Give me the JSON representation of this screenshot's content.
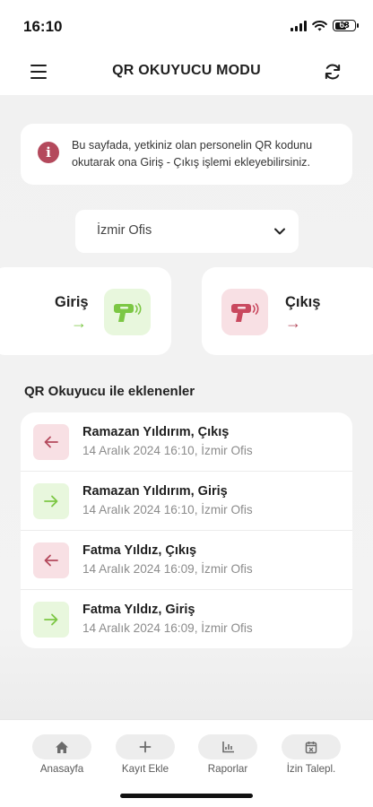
{
  "status_bar": {
    "time": "16:10",
    "battery": "63",
    "battery_level": 0.63
  },
  "header": {
    "title": "QR OKUYUCU MODU",
    "left_icon": "menu-icon",
    "right_icon": "refresh-icon"
  },
  "info": {
    "icon": "info-icon",
    "text": "Bu sayfada, yetkiniz olan personelin QR kodunu okutarak ona Giriş - Çıkış işlemi ekleyebilirsiniz."
  },
  "office_select": {
    "value": "İzmir Ofis",
    "icon": "chevron-down-icon"
  },
  "actions": {
    "entry": {
      "label": "Giriş",
      "arrow": "→",
      "icon": "qr-scanner-icon",
      "color": "#7cc744"
    },
    "exit": {
      "label": "Çıkış",
      "arrow": "→",
      "icon": "qr-scanner-icon",
      "color": "#c9495f"
    }
  },
  "list": {
    "title": "QR Okuyucu ile eklenenler",
    "items": [
      {
        "type": "out",
        "title": "Ramazan Yıldırım, Çıkış",
        "subtitle": "14 Aralık 2024 16:10, İzmir Ofis"
      },
      {
        "type": "in",
        "title": "Ramazan Yıldırım, Giriş",
        "subtitle": "14 Aralık 2024 16:10, İzmir Ofis"
      },
      {
        "type": "out",
        "title": "Fatma Yıldız, Çıkış",
        "subtitle": "14 Aralık 2024 16:09, İzmir Ofis"
      },
      {
        "type": "in",
        "title": "Fatma Yıldız, Giriş",
        "subtitle": "14 Aralık 2024 16:09, İzmir Ofis"
      }
    ]
  },
  "tabbar": {
    "tabs": [
      {
        "label": "Anasayfa",
        "icon": "home-icon"
      },
      {
        "label": "Kayıt Ekle",
        "icon": "plus-icon"
      },
      {
        "label": "Raporlar",
        "icon": "chart-icon"
      },
      {
        "label": "İzin Talepl.",
        "icon": "calendar-icon"
      }
    ]
  },
  "colors": {
    "accent_green": "#7cc744",
    "accent_red": "#c9495f",
    "info_icon": "#b4495c"
  }
}
